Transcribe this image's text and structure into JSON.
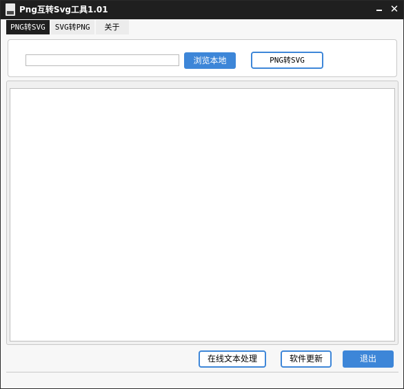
{
  "window": {
    "title": "Png互转Svg工具1.01",
    "minimize_label": "",
    "close_label": "✕"
  },
  "tabs": [
    {
      "label": "PNG转SVG",
      "active": true
    },
    {
      "label": "SVG转PNG",
      "active": false
    },
    {
      "label": "关于",
      "active": false
    }
  ],
  "top_panel": {
    "path_value": "",
    "browse_label": "浏览本地",
    "convert_label": "PNG转SVG"
  },
  "bottom": {
    "online_label": "在线文本处理",
    "update_label": "软件更新",
    "exit_label": "退出"
  },
  "colors": {
    "accent": "#3d86d8",
    "titlebar": "#1f1f1f"
  },
  "icons": {
    "app": "svg-file-icon",
    "minimize": "minimize-icon",
    "close": "close-icon"
  }
}
